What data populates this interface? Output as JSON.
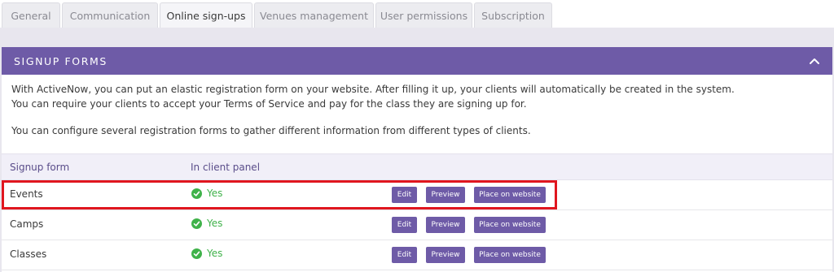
{
  "tabs": [
    {
      "label": "General",
      "active": false
    },
    {
      "label": "Communication",
      "active": false
    },
    {
      "label": "Online sign-ups",
      "active": true
    },
    {
      "label": "Venues management",
      "active": false
    },
    {
      "label": "User permissions",
      "active": false
    },
    {
      "label": "Subscription",
      "active": false
    }
  ],
  "panel": {
    "title": "SIGNUP FORMS",
    "intro": [
      "With ActiveNow, you can put an elastic registration form on your website. After filling it up, your clients will automatically be created in the system.",
      "You can require your clients to accept your Terms of Service and pay for the class they are signing up for.",
      "You can configure several registration forms to gather different information from different types of clients."
    ]
  },
  "table": {
    "columns": [
      "Signup form",
      "In client panel"
    ],
    "rows": [
      {
        "name": "Events",
        "status": "Yes",
        "edit": "Edit",
        "preview": "Preview",
        "place": "Place on website"
      },
      {
        "name": "Camps",
        "status": "Yes",
        "edit": "Edit",
        "preview": "Preview",
        "place": "Place on website"
      },
      {
        "name": "Classes",
        "status": "Yes",
        "edit": "Edit",
        "preview": "Preview",
        "place": "Place on website"
      }
    ]
  },
  "colors": {
    "accent": "#6e5ba7",
    "status_green": "#3fb24a",
    "highlight": "#e0161f"
  },
  "icons": {
    "collapse": "chevron-up-icon",
    "status": "check-circle-icon"
  }
}
